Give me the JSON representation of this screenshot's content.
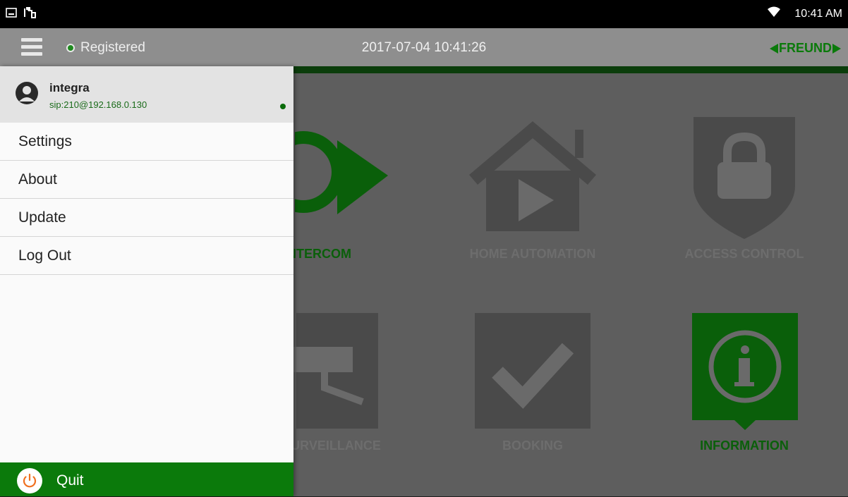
{
  "status_bar": {
    "time": "10:41 AM",
    "icons": [
      "gallery-icon",
      "usb-icon",
      "wifi-icon"
    ]
  },
  "app_bar": {
    "registration_status": "Registered",
    "datetime": "2017-07-04 10:41:26",
    "logo": "FREUND"
  },
  "tiles": [
    {
      "label": "INTERCOM",
      "icon": "intercom-icon",
      "active": true
    },
    {
      "label": "HOME AUTOMATION",
      "icon": "home-automation-icon",
      "active": false
    },
    {
      "label": "ACCESS CONTROL",
      "icon": "access-control-icon",
      "active": false
    },
    {
      "label": "SURVEILLANCE",
      "icon": "surveillance-camera-icon",
      "active": false
    },
    {
      "label": "BOOKING",
      "icon": "booking-check-icon",
      "active": false
    },
    {
      "label": "INFORMATION",
      "icon": "information-icon",
      "active": true
    }
  ],
  "drawer": {
    "user": {
      "name": "integra",
      "sip": "sip:210@192.168.0.130"
    },
    "menu": [
      {
        "label": "Settings"
      },
      {
        "label": "About"
      },
      {
        "label": "Update"
      },
      {
        "label": "Log Out"
      }
    ],
    "quit_label": "Quit"
  },
  "colors": {
    "accent_green": "#0b7a0b",
    "app_bar_gray": "#8e8e8e",
    "dim_overlay": "#5e5e5e",
    "quit_icon": "#f07020"
  }
}
